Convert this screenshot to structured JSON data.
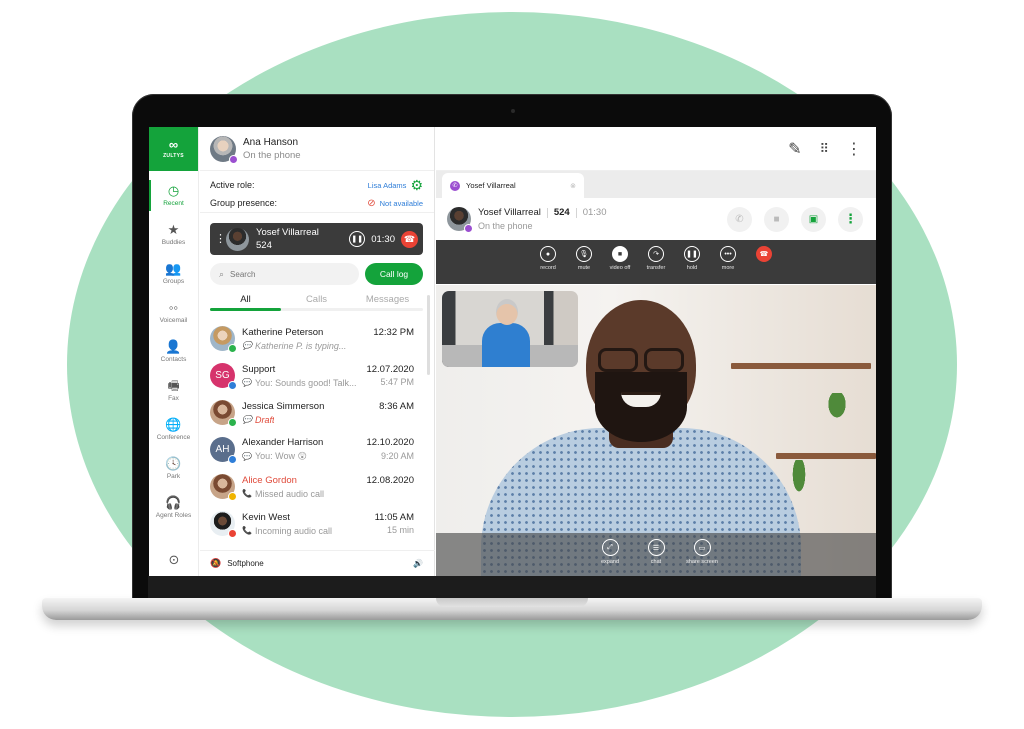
{
  "colors": {
    "brand_green": "#14a33b",
    "background_ellipse": "#a9e0c1",
    "link_blue": "#2f7ed8",
    "danger_red": "#ea4335",
    "call_purple": "#9b4fd0"
  },
  "app": {
    "logo_text": "ZULTYS"
  },
  "nav": {
    "items": [
      {
        "label": "Recent",
        "icon": "history-icon",
        "glyph": "◷",
        "active": true
      },
      {
        "label": "Buddies",
        "icon": "star-icon",
        "glyph": "★",
        "active": false
      },
      {
        "label": "Groups",
        "icon": "group-icon",
        "glyph": "👥",
        "active": false
      },
      {
        "label": "Voicemail",
        "icon": "voicemail-icon",
        "glyph": "◦◦",
        "active": false
      },
      {
        "label": "Contacts",
        "icon": "contact-icon",
        "glyph": "👤",
        "active": false
      },
      {
        "label": "Fax",
        "icon": "fax-icon",
        "glyph": "🖷",
        "active": false
      },
      {
        "label": "Conference",
        "icon": "globe-icon",
        "glyph": "🌐",
        "active": false
      },
      {
        "label": "Park",
        "icon": "clock-icon",
        "glyph": "🕓",
        "active": false
      },
      {
        "label": "Agent Roles",
        "icon": "headset-icon",
        "glyph": "🎧",
        "active": false
      }
    ],
    "location_icon": "map-pin-icon"
  },
  "user": {
    "name": "Ana Hanson",
    "status": "On the phone",
    "status_badge_color": "#9b4fd0"
  },
  "roles": {
    "active_role_label": "Active role:",
    "active_role_value": "Lisa Adams",
    "group_presence_label": "Group presence:",
    "group_presence_value": "Not available"
  },
  "active_call": {
    "name": "Yosef Villarreal",
    "extension": "524",
    "timer": "01:30"
  },
  "search": {
    "placeholder": "Search",
    "value": ""
  },
  "call_log_label": "Call log",
  "tabs": [
    {
      "label": "All",
      "active": true
    },
    {
      "label": "Calls",
      "active": false
    },
    {
      "label": "Messages",
      "active": false
    }
  ],
  "conversations": [
    {
      "name": "Katherine Peterson",
      "time": "12:32 PM",
      "sub": "Katherine P. is typing...",
      "sub_time": "",
      "sub_icon": "💬",
      "style": "italic",
      "avatar": "photo blond",
      "badge": "#2bb24c",
      "initials": "",
      "name_style": ""
    },
    {
      "name": "Support",
      "time": "12.07.2020",
      "sub": "You: Sounds good! Talk...",
      "sub_time": "5:47 PM",
      "sub_icon": "💬",
      "style": "",
      "avatar": "initials",
      "avatar_color": "#d6336c",
      "badge": "#2f7ed8",
      "initials": "SG",
      "name_style": ""
    },
    {
      "name": "Jessica Simmerson",
      "time": "8:36 AM",
      "sub": "Draft",
      "sub_time": "",
      "sub_icon": "💬",
      "style": "draft",
      "avatar": "photo warm",
      "badge": "#2bb24c",
      "initials": "",
      "name_style": ""
    },
    {
      "name": "Alexander Harrison",
      "time": "12.10.2020",
      "sub": "You: Wow 😲",
      "sub_time": "9:20 AM",
      "sub_icon": "💬",
      "style": "",
      "avatar": "initials",
      "avatar_color": "#5a6e8c",
      "badge": "#2f7ed8",
      "initials": "AH",
      "name_style": ""
    },
    {
      "name": "Alice Gordon",
      "time": "12.08.2020",
      "sub": "Missed audio call",
      "sub_time": "",
      "sub_icon": "📞",
      "style": "",
      "avatar": "photo warm",
      "badge": "#f0b400",
      "initials": "",
      "name_style": "missed"
    },
    {
      "name": "Kevin West",
      "time": "11:05 AM",
      "sub": "Incoming audio call",
      "sub_time": "15 min",
      "sub_icon": "📞",
      "style": "",
      "avatar": "photo kevin",
      "badge": "#ea4335",
      "initials": "",
      "name_style": ""
    }
  ],
  "softphone": {
    "label": "Softphone"
  },
  "call_panel": {
    "tab_title": "Yosef Villarreal",
    "peer_name": "Yosef Villarreal",
    "peer_extension": "524",
    "peer_timer": "01:30",
    "peer_status": "On the phone",
    "controls": [
      {
        "label": "record",
        "glyph": "●",
        "variant": ""
      },
      {
        "label": "mute",
        "glyph": "🎙",
        "variant": ""
      },
      {
        "label": "video off",
        "glyph": "■",
        "variant": "filled"
      },
      {
        "label": "transfer",
        "glyph": "↷",
        "variant": ""
      },
      {
        "label": "hold",
        "glyph": "❚❚",
        "variant": ""
      },
      {
        "label": "more",
        "glyph": "•••",
        "variant": ""
      },
      {
        "label": "",
        "glyph": "☎",
        "variant": "red"
      }
    ],
    "video_controls": [
      {
        "label": "expand",
        "glyph": "⤢"
      },
      {
        "label": "chat",
        "glyph": "☰"
      },
      {
        "label": "share screen",
        "glyph": "▭"
      }
    ]
  }
}
